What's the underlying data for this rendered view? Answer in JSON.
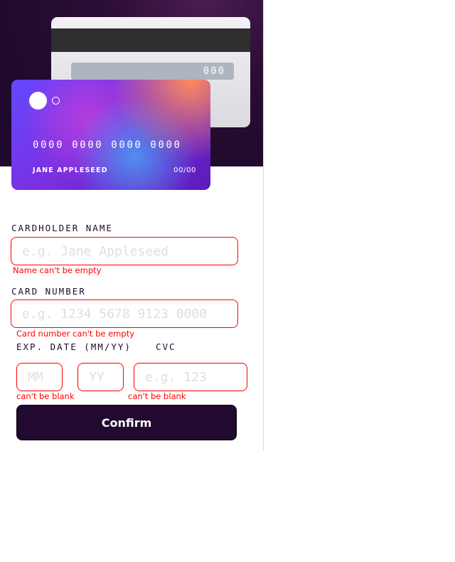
{
  "card_back": {
    "cvc_display": "000"
  },
  "card_front": {
    "number_display": "0000 0000 0000 0000",
    "holder_display": "JANE APPLESEED",
    "expiry_display": "00/00"
  },
  "form": {
    "name": {
      "label": "Cardholder Name",
      "placeholder": "e.g. Jane Appleseed",
      "error": "Name can't be empty"
    },
    "number": {
      "label": "Card Number",
      "placeholder": "e.g. 1234 5678 9123 0000",
      "error": "Card number can't be empty"
    },
    "expiry": {
      "label": "Exp. Date (MM/YY)",
      "month_placeholder": "MM",
      "year_placeholder": "YY",
      "error": "can't be blank"
    },
    "cvc": {
      "label": "CVC",
      "placeholder": "e.g. 123",
      "error": "can't be blank"
    },
    "confirm_label": "Confirm"
  },
  "colors": {
    "dark_violet": "#21092f",
    "error_red": "#ff0000",
    "gradient_start": "#6449fe",
    "gradient_end": "#610595",
    "placeholder_gray": "#dfdee0"
  }
}
